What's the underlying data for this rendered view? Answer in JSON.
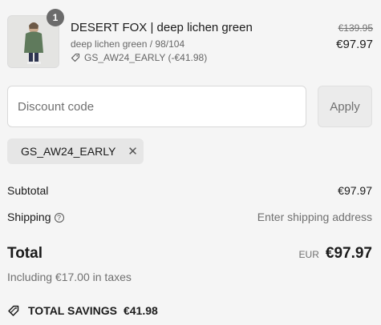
{
  "line_item": {
    "quantity": "1",
    "title": "DESERT FOX | deep lichen green",
    "variant": "deep lichen green / 98/104",
    "discount": "GS_AW24_EARLY (-€41.98)",
    "price_original": "€139.95",
    "price_final": "€97.97"
  },
  "discount_form": {
    "placeholder": "Discount code",
    "apply_label": "Apply"
  },
  "applied_code": {
    "code": "GS_AW24_EARLY"
  },
  "summary": {
    "subtotal_label": "Subtotal",
    "subtotal_value": "€97.97",
    "shipping_label": "Shipping",
    "shipping_value": "Enter shipping address",
    "total_label": "Total",
    "currency": "EUR",
    "total_value": "€97.97",
    "taxes": "Including €17.00 in taxes",
    "savings_label": "TOTAL SAVINGS",
    "savings_value": "€41.98"
  },
  "icons": {
    "tag": "tag-icon",
    "close": "close-icon",
    "help": "help-circle-icon",
    "savings": "savings-tag-icon"
  }
}
